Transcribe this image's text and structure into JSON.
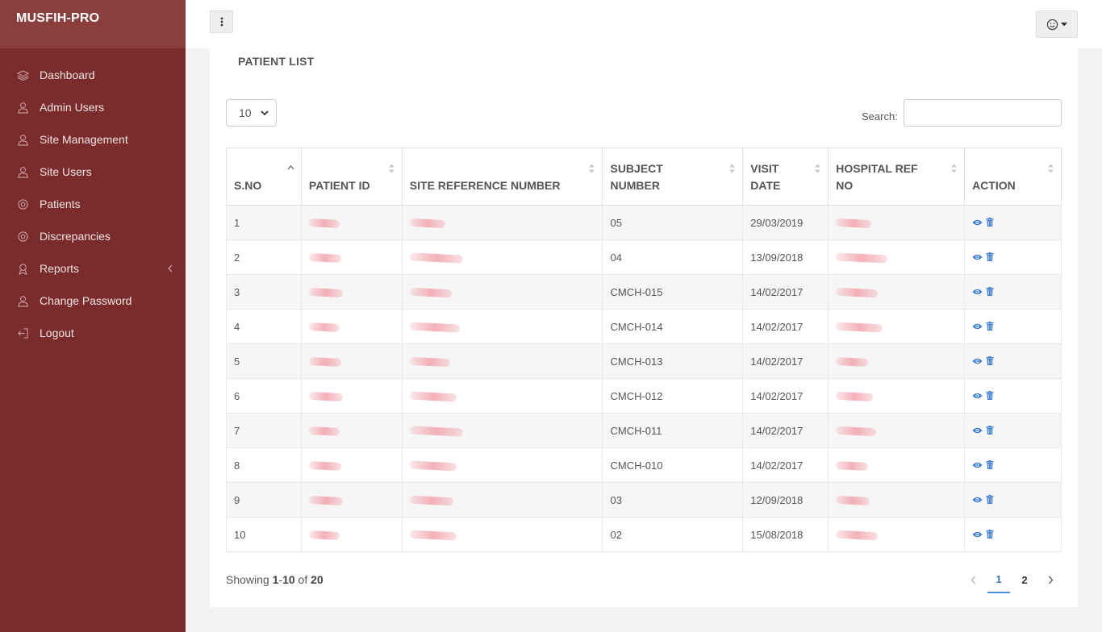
{
  "app": {
    "brand": "MUSFIH-PRO"
  },
  "sidebar": {
    "items": [
      {
        "label": "Dashboard",
        "icon": "layers-icon"
      },
      {
        "label": "Admin Users",
        "icon": "user-icon"
      },
      {
        "label": "Site Management",
        "icon": "user-icon"
      },
      {
        "label": "Site Users",
        "icon": "user-icon"
      },
      {
        "label": "Patients",
        "icon": "settings-icon"
      },
      {
        "label": "Discrepancies",
        "icon": "settings-icon"
      },
      {
        "label": "Reports",
        "icon": "reports-icon",
        "has_submenu": true
      },
      {
        "label": "Change Password",
        "icon": "user-icon"
      },
      {
        "label": "Logout",
        "icon": "logout-icon"
      }
    ]
  },
  "topbar": {
    "menu_icon": "vertical-dots-icon",
    "user_icon": "smiley-icon"
  },
  "page": {
    "title": "PATIENT LIST",
    "length_value": "10",
    "search_label": "Search:",
    "search_value": ""
  },
  "table": {
    "headers": [
      [
        "S.NO"
      ],
      [
        "PATIENT ID"
      ],
      [
        "SITE REFERENCE NUMBER"
      ],
      [
        "SUBJECT",
        "NUMBER"
      ],
      [
        "VISIT",
        "DATE"
      ],
      [
        "HOSPITAL REF",
        "NO"
      ],
      [
        "ACTION"
      ]
    ],
    "rows": [
      {
        "sno": "1",
        "subject": "05",
        "visit": "29/03/2019"
      },
      {
        "sno": "2",
        "subject": "04",
        "visit": "13/09/2018"
      },
      {
        "sno": "3",
        "subject": "CMCH-015",
        "visit": "14/02/2017"
      },
      {
        "sno": "4",
        "subject": "CMCH-014",
        "visit": "14/02/2017"
      },
      {
        "sno": "5",
        "subject": "CMCH-013",
        "visit": "14/02/2017"
      },
      {
        "sno": "6",
        "subject": "CMCH-012",
        "visit": "14/02/2017"
      },
      {
        "sno": "7",
        "subject": "CMCH-011",
        "visit": "14/02/2017"
      },
      {
        "sno": "8",
        "subject": "CMCH-010",
        "visit": "14/02/2017"
      },
      {
        "sno": "9",
        "subject": "03",
        "visit": "12/09/2018"
      },
      {
        "sno": "10",
        "subject": "02",
        "visit": "15/08/2018"
      }
    ]
  },
  "footer": {
    "showing_prefix": "Showing ",
    "range_start": "1",
    "range_sep": "-",
    "range_end": "10",
    "of_text": " of ",
    "total": "20",
    "pages": [
      "1",
      "2"
    ],
    "current_page": "1"
  },
  "colors": {
    "sidebar": "#7a2c2c",
    "brand_bg": "#8a3f3d",
    "accent": "#4a90e2",
    "action_icon": "#3b7dd8"
  }
}
